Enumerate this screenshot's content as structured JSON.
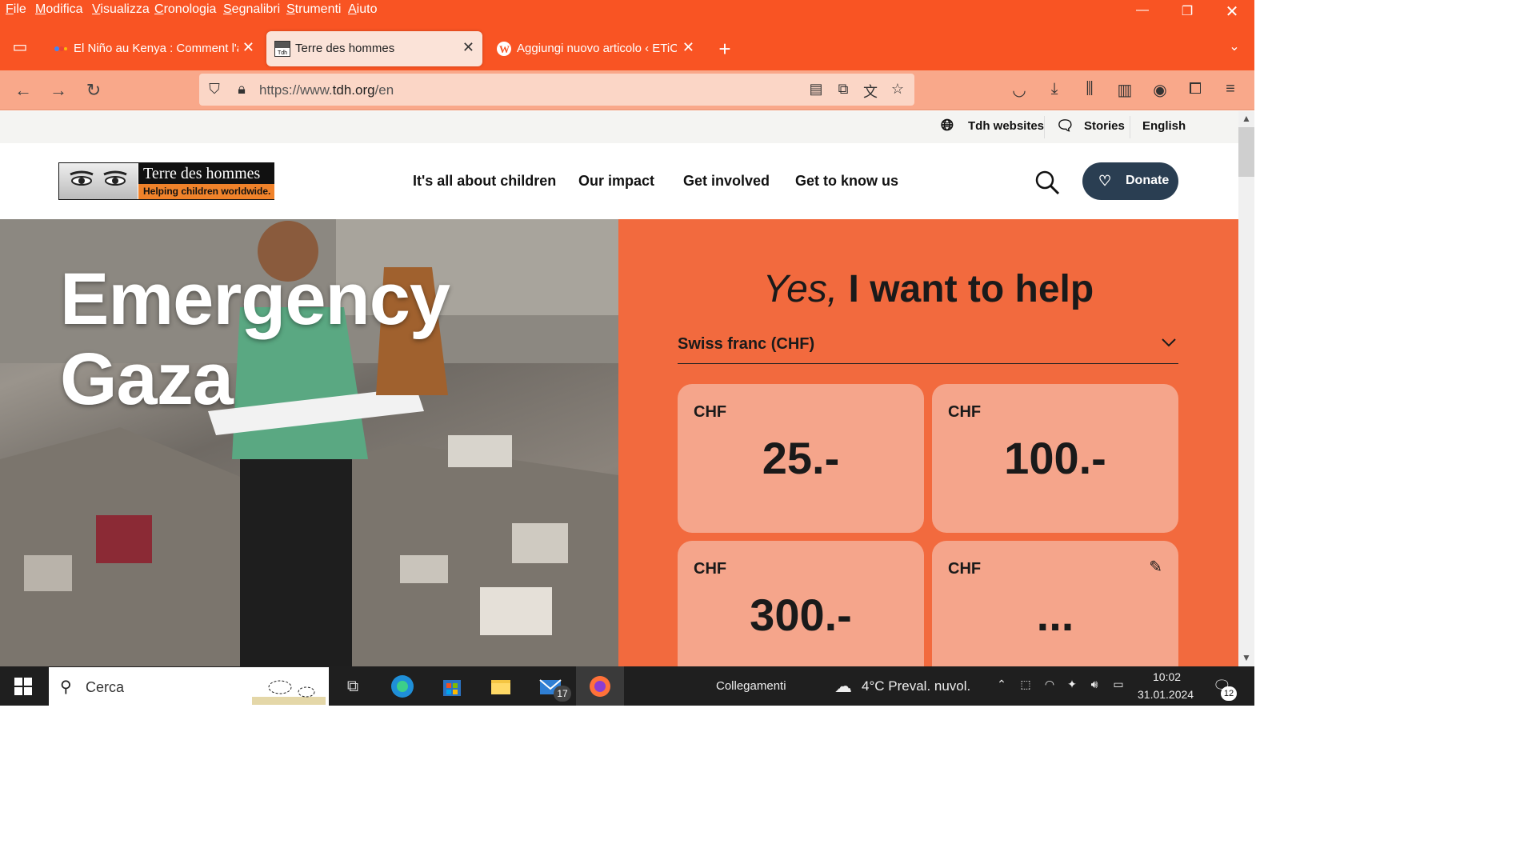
{
  "menubar": {
    "items": [
      {
        "first": "F",
        "rest": "ile"
      },
      {
        "first": "M",
        "rest": "odifica"
      },
      {
        "first": "V",
        "rest": "isualizza"
      },
      {
        "first": "C",
        "rest": "ronologia"
      },
      {
        "first": "S",
        "rest": "egnalibri"
      },
      {
        "first": "S",
        "rest": "trumenti"
      },
      {
        "first": "A",
        "rest": "iuto"
      }
    ]
  },
  "tabs": [
    {
      "title": "El Niño au Kenya : Comment l'a",
      "active": false
    },
    {
      "title": "Terre des hommes",
      "active": true
    },
    {
      "title": "Aggiungi nuovo articolo ‹ ETiCi",
      "active": false
    }
  ],
  "navbar": {
    "url_prefix": "https://www.",
    "url_domain": "tdh.org",
    "url_path": "/en"
  },
  "page": {
    "topstrip": {
      "websites": "Tdh websites",
      "stories": "Stories",
      "language": "English"
    },
    "logo": {
      "title": "Terre des hommes",
      "subtitle": "Helping children worldwide."
    },
    "nav": [
      "It's all about children",
      "Our impact",
      "Get involved",
      "Get to know us"
    ],
    "donate_label": "Donate",
    "hero_title": "Emergency Gaza",
    "panel": {
      "heading_italic": "Yes,",
      "heading_rest": "I want to help",
      "currency": "Swiss franc (CHF)",
      "amounts": [
        {
          "currency": "CHF",
          "value": "25.-"
        },
        {
          "currency": "CHF",
          "value": "100.-"
        },
        {
          "currency": "CHF",
          "value": "300.-"
        },
        {
          "currency": "CHF",
          "value": "..."
        }
      ]
    }
  },
  "taskbar": {
    "search_placeholder": "Cerca",
    "mail_badge": "17",
    "links_label": "Collegamenti",
    "weather": "4°C  Preval. nuvol.",
    "time": "10:02",
    "date": "31.01.2024",
    "notifications": "12"
  },
  "colors": {
    "chrome": "#f95423",
    "panel": "#f26a3e",
    "card": "#f5a58b",
    "donate": "#2a3e52"
  }
}
